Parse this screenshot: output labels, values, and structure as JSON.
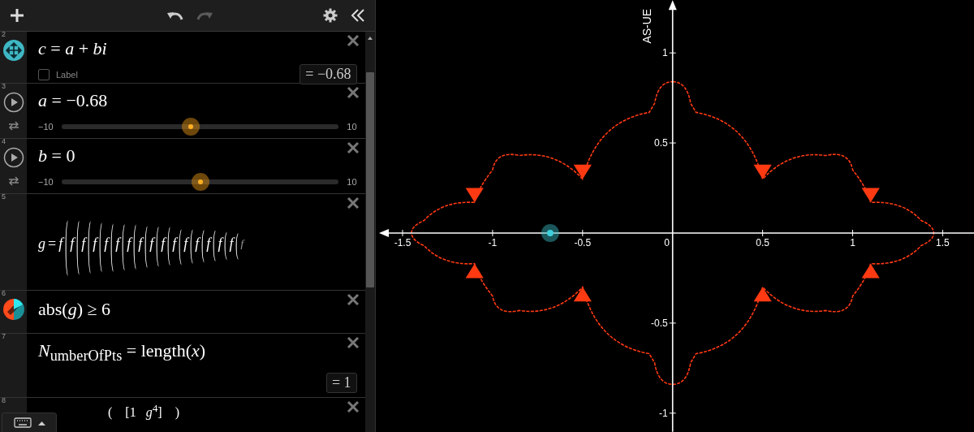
{
  "toolbar": {
    "undo": {
      "disabled": false
    },
    "redo": {
      "disabled": true
    }
  },
  "expressions": [
    {
      "kind": "point",
      "number": "2",
      "latex": "*c* = *a* + *bi*",
      "label_checkbox": {
        "text": "Label",
        "checked": false
      },
      "result": "= −0.68"
    },
    {
      "kind": "slider",
      "number": "3",
      "latex": "*a* = −0.68",
      "min": "−10",
      "max": "10",
      "level": 0.466
    },
    {
      "kind": "slider",
      "number": "4",
      "latex": "*b* = 0",
      "min": "−10",
      "max": "10",
      "level": 0.5
    },
    {
      "kind": "nested",
      "number": "5",
      "lhs": "g",
      "relation": "=",
      "terms": [
        {
          "name": "f"
        },
        {
          "open": "(",
          "name": "f"
        },
        {
          "open": "(",
          "name": "f"
        },
        {
          "open": "(",
          "name": "f"
        },
        {
          "open": "(",
          "name": "f"
        },
        {
          "open": "(",
          "name": "f"
        },
        {
          "open": "(",
          "name": "f"
        },
        {
          "open": "(",
          "name": "f"
        },
        {
          "open": "(",
          "name": "f"
        },
        {
          "open": "(",
          "name": "f"
        },
        {
          "open": "(",
          "name": "f"
        },
        {
          "open": "(",
          "name": "f"
        },
        {
          "open": "(",
          "name": "f"
        },
        {
          "open": "(",
          "name": "f"
        },
        {
          "open": "(",
          "name": "f"
        },
        {
          "open": "(",
          "name": "f"
        },
        {
          "open": "(",
          "name": "f"
        }
      ]
    },
    {
      "kind": "inequality",
      "number": "6",
      "latex": "abs(*g*) ≥ 6"
    },
    {
      "kind": "expression",
      "number": "7",
      "latex": "*N*$_{umberOfPts}$ = length(*x*)",
      "result": "= 1"
    },
    {
      "kind": "partial",
      "number": "8",
      "latex": "(    [1   *g*$^{4}$]    )"
    }
  ],
  "graph": {
    "y_axis_label": "AS-UE",
    "x_ticks": [
      "-1.5",
      "-1",
      "-0.5",
      "0",
      "0.5",
      "1",
      "1.5"
    ],
    "y_ticks": [
      "1",
      "0.5",
      "-0.5",
      "-1"
    ]
  }
}
